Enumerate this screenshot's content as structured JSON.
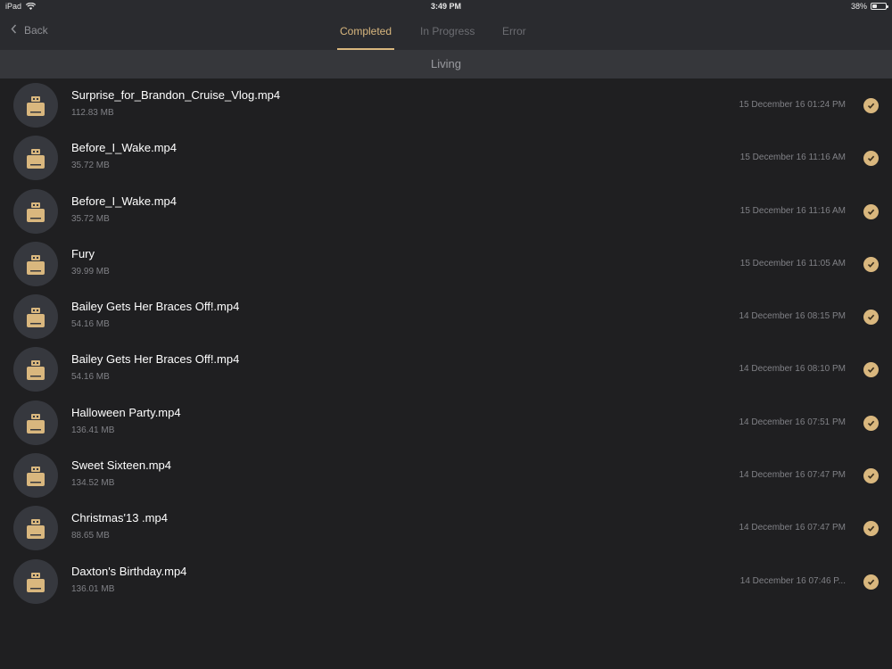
{
  "status_bar": {
    "device": "iPad",
    "time": "3:49 PM",
    "battery_percent": "38%",
    "battery_level": 0.38
  },
  "nav": {
    "back_label": "Back",
    "tabs": [
      {
        "label": "Completed",
        "active": true
      },
      {
        "label": "In Progress",
        "active": false
      },
      {
        "label": "Error",
        "active": false
      }
    ]
  },
  "section": {
    "title": "Living"
  },
  "items": [
    {
      "title": "Surprise_for_Brandon_Cruise_Vlog.mp4",
      "size": "112.83 MB",
      "date": "15 December 16 01:24 PM"
    },
    {
      "title": "Before_I_Wake.mp4",
      "size": "35.72 MB",
      "date": "15 December 16 11:16 AM"
    },
    {
      "title": "Before_I_Wake.mp4",
      "size": "35.72 MB",
      "date": "15 December 16 11:16 AM"
    },
    {
      "title": "Fury",
      "size": "39.99 MB",
      "date": "15 December 16 11:05 AM"
    },
    {
      "title": "Bailey Gets Her Braces Off!.mp4",
      "size": "54.16 MB",
      "date": "14 December 16 08:15 PM"
    },
    {
      "title": "Bailey Gets Her Braces Off!.mp4",
      "size": "54.16 MB",
      "date": "14 December 16 08:10 PM"
    },
    {
      "title": "Halloween Party.mp4",
      "size": "136.41 MB",
      "date": "14 December 16 07:51 PM"
    },
    {
      "title": "Sweet Sixteen.mp4",
      "size": "134.52 MB",
      "date": "14 December 16 07:47 PM"
    },
    {
      "title": "Christmas'13 .mp4",
      "size": "88.65 MB",
      "date": "14 December 16 07:47 PM"
    },
    {
      "title": "Daxton's Birthday.mp4",
      "size": "136.01 MB",
      "date": "14 December 16 07:46 P..."
    }
  ],
  "icons": {
    "thumbnail": "device-drive-icon",
    "status": "check-icon",
    "back": "chevron-left-icon"
  },
  "colors": {
    "accent": "#d9b77e",
    "background": "#1f1f21",
    "bar": "#2a2b2f",
    "section": "#36373b"
  }
}
